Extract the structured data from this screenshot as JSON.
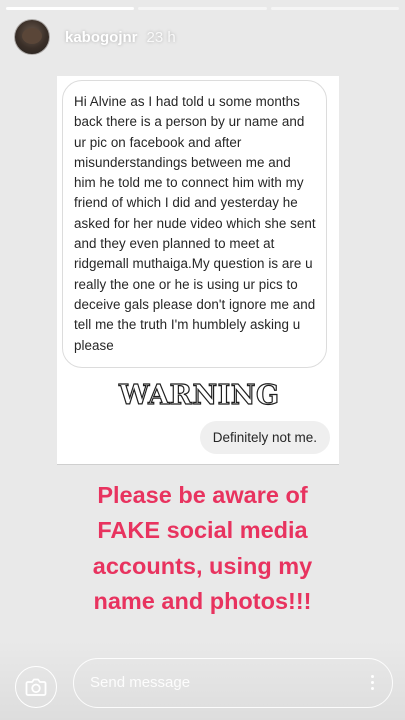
{
  "story": {
    "progress_segments": 3,
    "progress_active": 1,
    "username": "kabogojnr",
    "time_ago": "23 h"
  },
  "message": {
    "incoming": "Hi Alvine as I had told u some months back there is a person by ur name and ur pic on facebook and after misunderstandings between me and him he told me to connect him with my friend of which I did and yesterday he asked for her nude video which she sent and they even planned to meet at ridgemall muthaiga.My question is are u really the one or he is using ur pics to deceive gals please don't ignore me and tell me the truth I'm humblely asking u please",
    "warning": "WARNING",
    "reply": "Definitely not me."
  },
  "caption": {
    "line1": "Please be aware of",
    "line2": "FAKE social media",
    "line3": "accounts, using my",
    "line4": "name and photos!!!"
  },
  "footer": {
    "placeholder": "Send message"
  },
  "icons": {
    "camera": "camera-icon",
    "more": "more-vertical-icon"
  }
}
